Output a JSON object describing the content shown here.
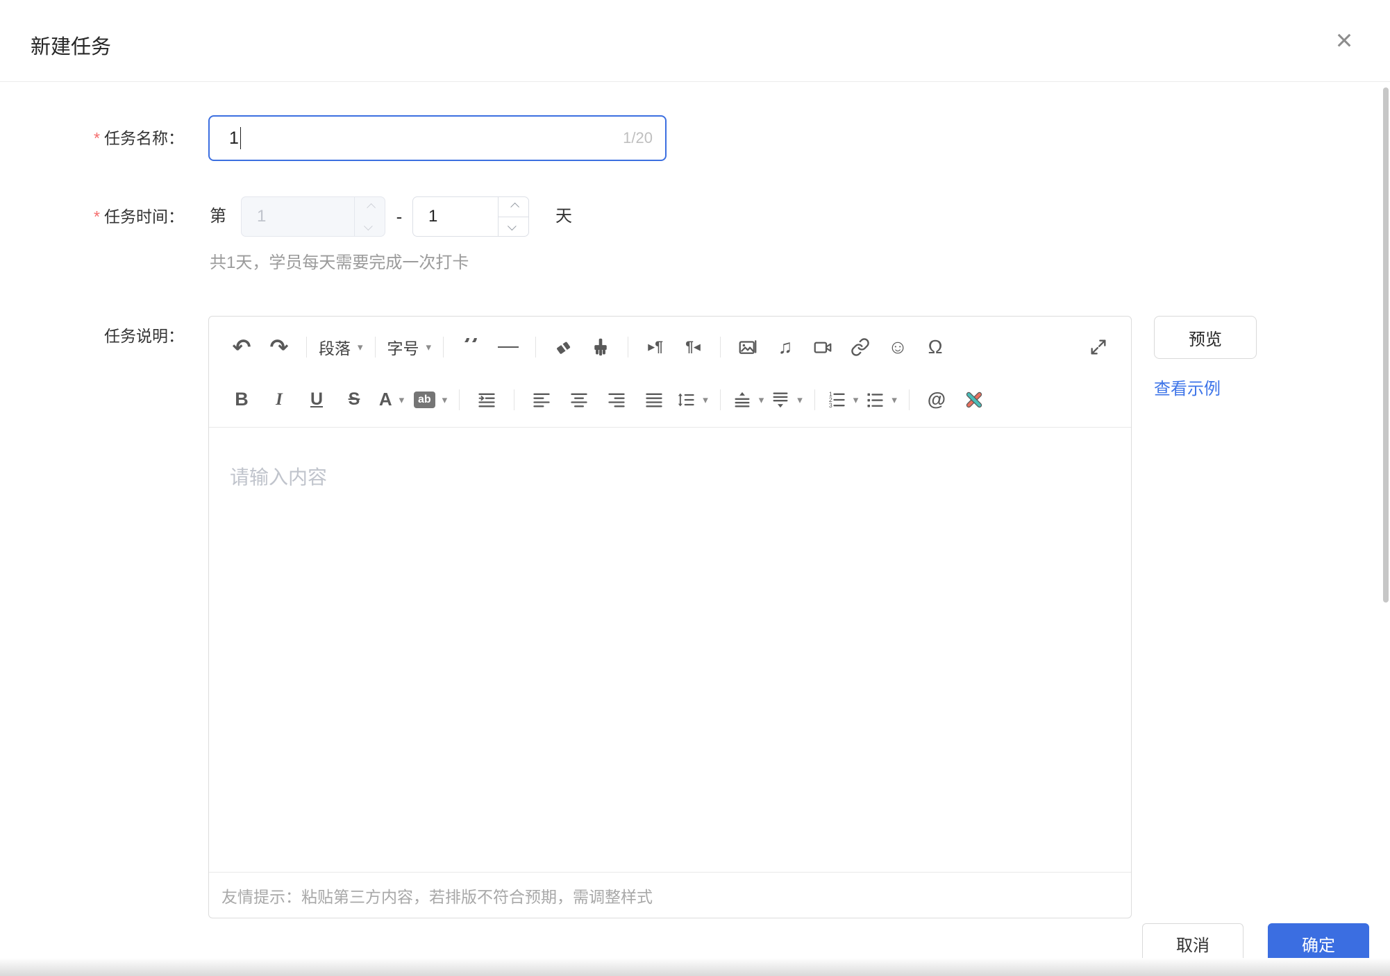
{
  "dialog": {
    "title": "新建任务"
  },
  "icons": {
    "close": "×",
    "undo": "↶",
    "redo": "↷",
    "caret": "▾",
    "quote": "”",
    "music": "♫",
    "emoji": "☺",
    "omega": "Ω",
    "at": "@",
    "pilcrow": "¶",
    "tri_right": "▶",
    "tri_left": "◀"
  },
  "form": {
    "task_name": {
      "required_mark": "*",
      "label": "任务名称：",
      "value": "1",
      "counter": "1/20"
    },
    "task_time": {
      "required_mark": "*",
      "label": "任务时间：",
      "prefix": "第",
      "start_value": "1",
      "separator": "-",
      "end_value": "1",
      "suffix": "天",
      "helper": "共1天，学员每天需要完成一次打卡"
    },
    "task_desc": {
      "label": "任务说明："
    }
  },
  "toolbar": {
    "paragraph": "段落",
    "font_size": "字号",
    "bold": "B",
    "italic": "I",
    "underline": "U",
    "strike": "S",
    "font_color": "A",
    "highlight": "ab"
  },
  "editor": {
    "placeholder": "请输入内容",
    "hint": "友情提示：粘贴第三方内容，若排版不符合预期，需调整样式"
  },
  "side": {
    "preview": "预览",
    "example": "查看示例"
  },
  "footer": {
    "cancel": "取消",
    "confirm": "确定"
  },
  "colors": {
    "primary": "#3b6ee1",
    "danger": "#f56c6c",
    "link": "#3d74e8",
    "focus_border": "#3c6fe0"
  }
}
